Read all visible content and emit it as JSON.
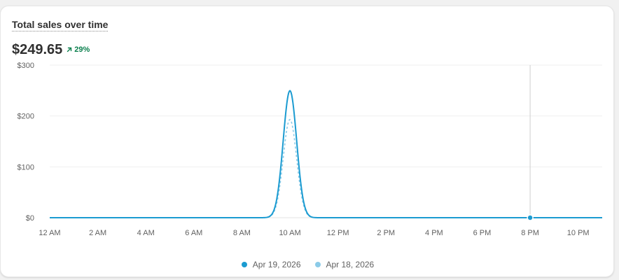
{
  "card": {
    "title": "Total sales over time",
    "value": "$249.65",
    "delta": "29%",
    "delta_color": "#0a7f4d"
  },
  "legend": [
    {
      "label": "Apr 19, 2026",
      "color": "#1b9bd1"
    },
    {
      "label": "Apr 18, 2026",
      "color": "#8bcbe8"
    }
  ],
  "chart_data": {
    "type": "line",
    "y_ticks": [
      "$0",
      "$100",
      "$200",
      "$300"
    ],
    "ylim": [
      0,
      300
    ],
    "x_ticks": [
      "12 AM",
      "2 AM",
      "4 AM",
      "6 AM",
      "8 AM",
      "10 AM",
      "12 PM",
      "2 PM",
      "4 PM",
      "6 PM",
      "8 PM",
      "10 PM"
    ],
    "xlim": [
      0,
      23
    ],
    "x_hours": [
      0,
      1,
      2,
      3,
      4,
      5,
      6,
      7,
      8,
      9,
      10,
      11,
      12,
      13,
      14,
      15,
      16,
      17,
      18,
      19,
      20,
      21,
      22,
      23
    ],
    "series": [
      {
        "name": "Apr 19, 2026",
        "color": "#1b9bd1",
        "dashed": false,
        "values": [
          0,
          0,
          0,
          0,
          0,
          0,
          0,
          0,
          0,
          0,
          249.65,
          0,
          0,
          0,
          0,
          0,
          0,
          0,
          0,
          0,
          0,
          0,
          0,
          0
        ]
      },
      {
        "name": "Apr 18, 2026",
        "color": "#8bcbe8",
        "dashed": true,
        "values": [
          0,
          0,
          0,
          0,
          0,
          0,
          0,
          0,
          0,
          0,
          193,
          0,
          0,
          0,
          0,
          0,
          0,
          0,
          0,
          0,
          0,
          0,
          0,
          0
        ]
      }
    ],
    "hover_hour": 20,
    "grid": true
  }
}
